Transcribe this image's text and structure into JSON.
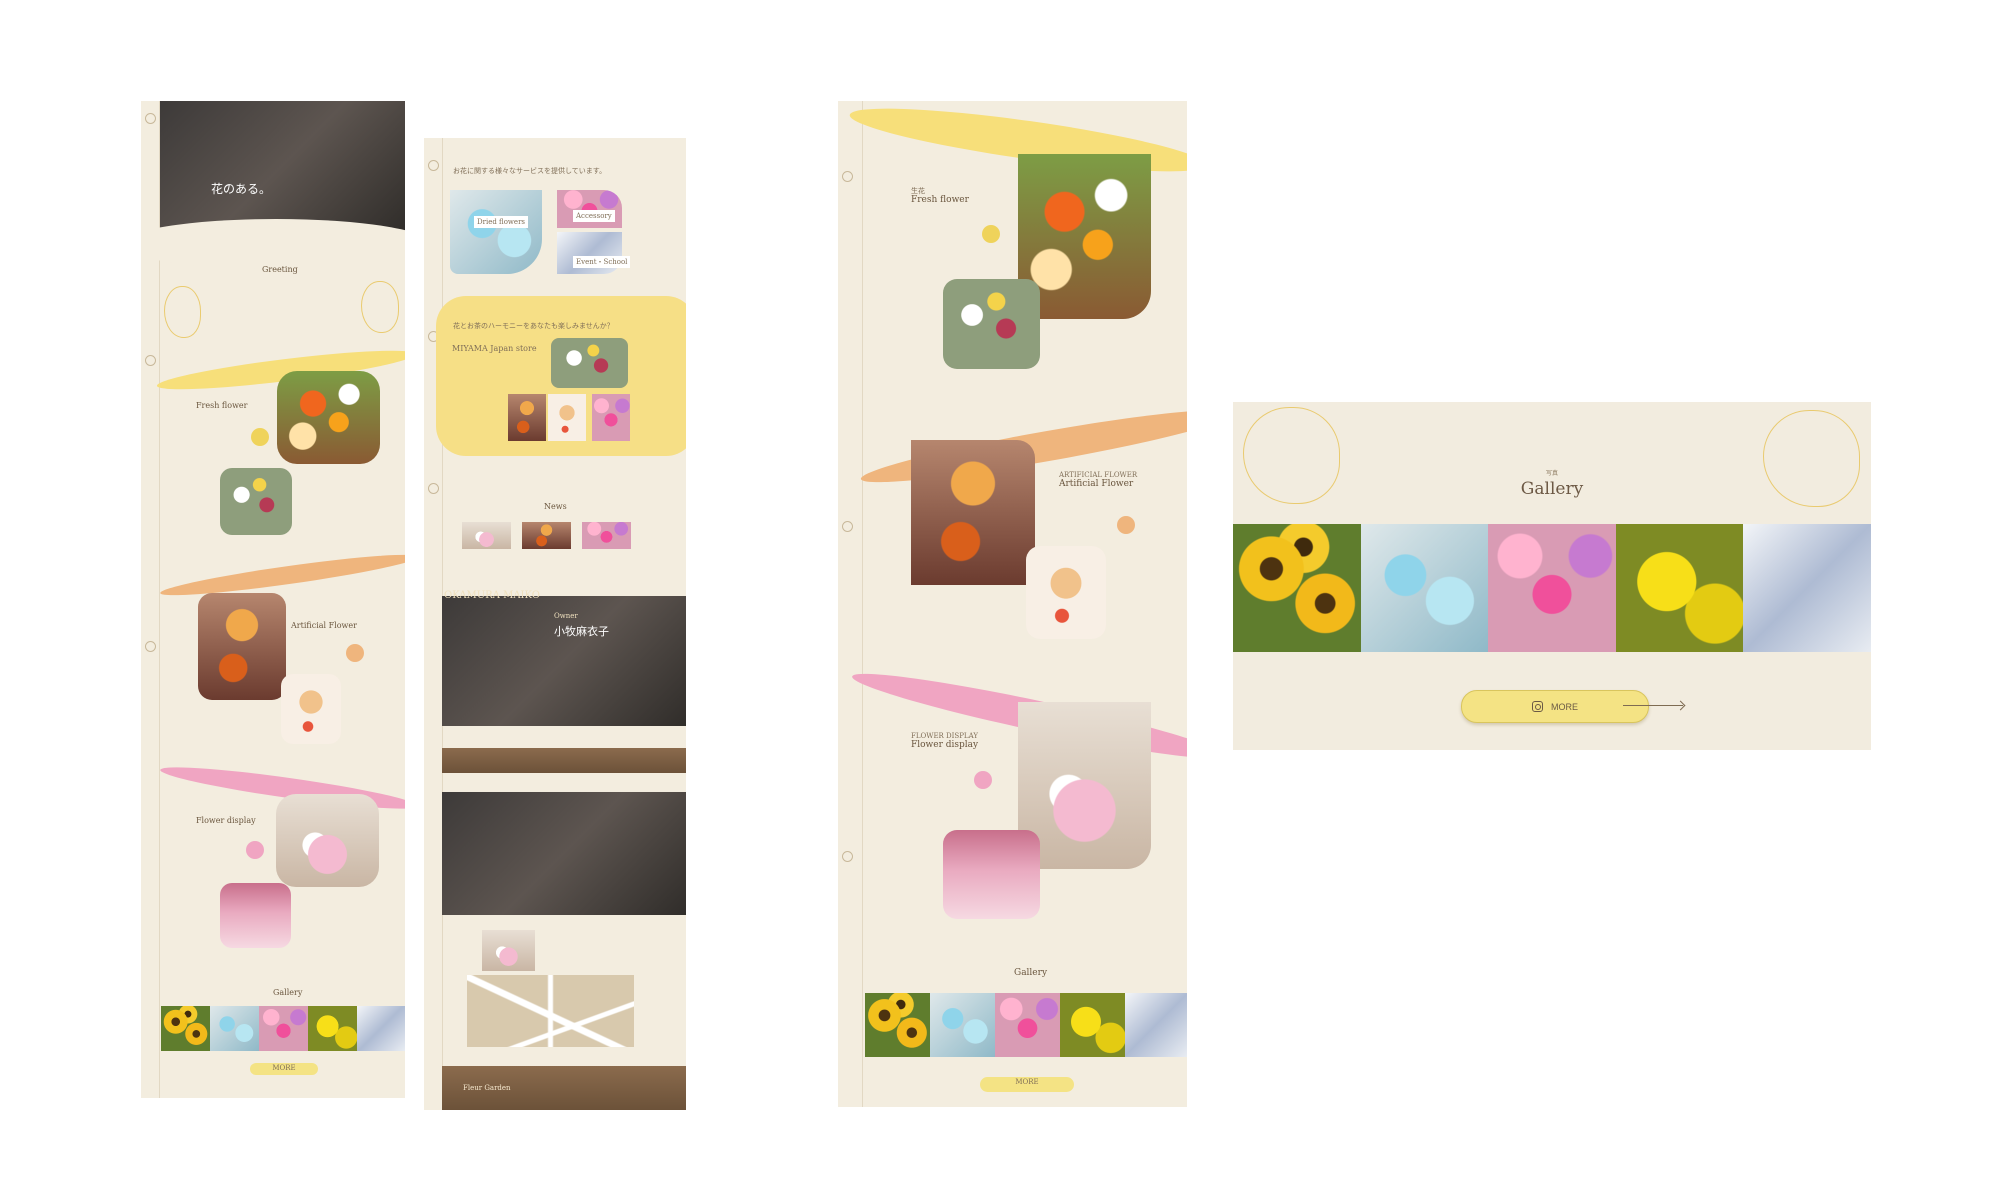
{
  "left_board": {
    "hero_text": "花のある。",
    "greeting_title": "Greeting",
    "fresh_title": "Fresh flower",
    "artificial_title": "Artificial Flower",
    "display_title": "Flower display",
    "gallery_title": "Gallery",
    "more_label": "MORE"
  },
  "middle_board": {
    "services_intro": "お花に関する様々なサービスを提供しています。",
    "card_1": "Dried flowers",
    "card_2": "Accessory",
    "card_3": "Event・School",
    "store_intro": "花とお茶のハーモニーをあなたも楽しみませんか？",
    "store_title": "MIYAMA Japan store",
    "news_title": "News",
    "owner_heading": "OKAMURA MAIKO",
    "owner_role": "Owner",
    "owner_name": "小牧麻衣子",
    "footer_name": "Fleur Garden"
  },
  "detail_board": {
    "fresh_kicker": "生花",
    "fresh_title": "Fresh flower",
    "artificial_kicker": "ARTIFICIAL FLOWER",
    "artificial_title": "Artificial Flower",
    "display_kicker": "FLOWER DISPLAY",
    "display_title": "Flower display",
    "gallery_title": "Gallery",
    "more_label": "MORE"
  },
  "gallery_panel": {
    "kicker": "写真",
    "title": "Gallery",
    "more_label": "MORE",
    "images": [
      "sunflowers",
      "blue flowers",
      "pink flowers",
      "yellow chrysanthemums",
      "silver flowers"
    ]
  },
  "colors": {
    "background": "#f3eddf",
    "accent_yellow": "#f4e384",
    "accent_orange": "#efb57d",
    "accent_pink": "#f0a5c2",
    "text": "#6b5a45"
  }
}
